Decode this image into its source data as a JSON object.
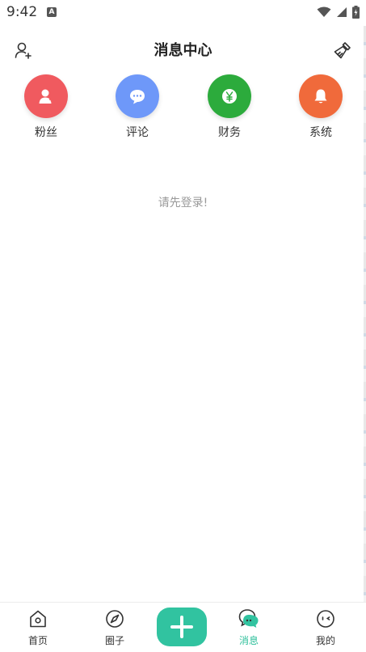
{
  "status": {
    "time": "9:42",
    "notification": "A"
  },
  "header": {
    "title": "消息中心"
  },
  "categories": [
    {
      "label": "粉丝",
      "color": "#f05a5f",
      "icon": "user-icon"
    },
    {
      "label": "评论",
      "color": "#6e98f9",
      "icon": "chat-bubble-icon"
    },
    {
      "label": "财务",
      "color": "#2cab3c",
      "icon": "yen-coin-icon"
    },
    {
      "label": "系统",
      "color": "#f06a3b",
      "icon": "bell-icon"
    }
  ],
  "empty_message": "请先登录!",
  "tabs": [
    {
      "label": "首页",
      "icon": "home-icon"
    },
    {
      "label": "圈子",
      "icon": "compass-icon"
    },
    {
      "label": "消息",
      "icon": "message-icon",
      "active": true
    },
    {
      "label": "我的",
      "icon": "profile-face-icon"
    }
  ],
  "accent_color": "#31c3a0"
}
